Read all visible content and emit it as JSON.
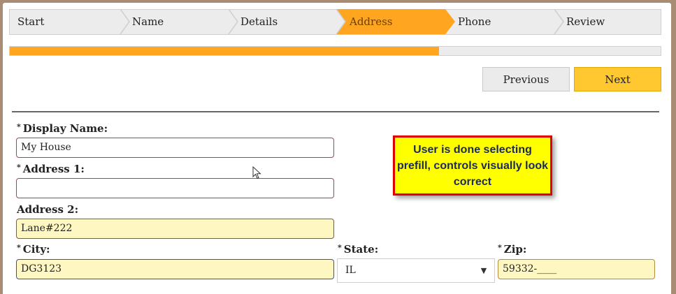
{
  "wizard": {
    "steps": [
      {
        "label": "Start",
        "active": false
      },
      {
        "label": "Name",
        "active": false
      },
      {
        "label": "Details",
        "active": false
      },
      {
        "label": "Address",
        "active": true
      },
      {
        "label": "Phone",
        "active": false
      },
      {
        "label": "Review",
        "active": false
      }
    ],
    "progress_fraction": 0.66
  },
  "nav": {
    "previous_label": "Previous",
    "next_label": "Next"
  },
  "form": {
    "display_name": {
      "required_mark": "*",
      "label": "Display Name:",
      "value": "My House"
    },
    "address1": {
      "required_mark": "*",
      "label": "Address 1:",
      "value": ""
    },
    "address2": {
      "label": "Address 2:",
      "value": "Lane#222"
    },
    "city": {
      "required_mark": "*",
      "label": "City:",
      "value": "DG3123"
    },
    "state": {
      "required_mark": "*",
      "label": "State:",
      "value": "IL"
    },
    "zip": {
      "required_mark": "*",
      "label": "Zip:",
      "value": "59332-____"
    }
  },
  "annotation": {
    "text": "User is done selecting prefill, controls visually look correct"
  },
  "colors": {
    "accent": "#ffa51f",
    "next_button": "#ffc830",
    "prefill": "#fff7c2",
    "callout_bg": "#ffff00",
    "callout_border": "#e00000"
  }
}
